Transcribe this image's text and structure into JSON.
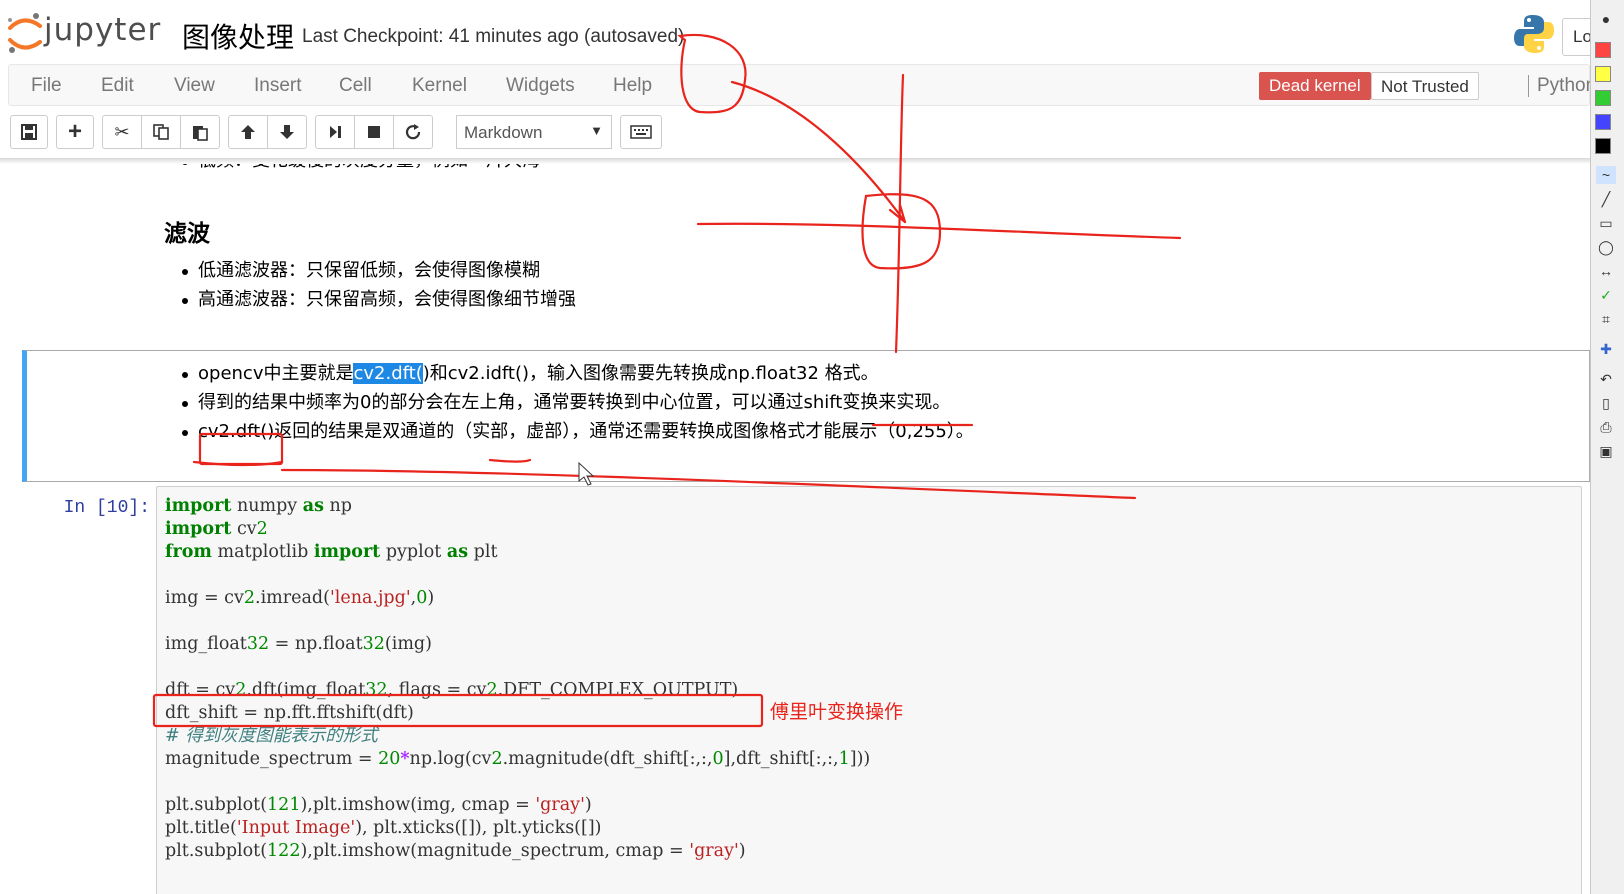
{
  "header": {
    "logo_text": "jupyter",
    "notebook_title": "图像处理",
    "checkpoint": "Last Checkpoint: 41 minutes ago (autosaved)",
    "logout_label": "Lo"
  },
  "menubar": {
    "items": [
      "File",
      "Edit",
      "View",
      "Insert",
      "Cell",
      "Kernel",
      "Widgets",
      "Help"
    ],
    "kernel_status": "Dead kernel",
    "trust_status": "Not Trusted",
    "kernel_name": "Python"
  },
  "toolbar": {
    "cell_type": "Markdown"
  },
  "notebook": {
    "top_bullet": "低频：变化缓慢的灰度分量，例如一片大海",
    "heading": "滤波",
    "filter_bullets": [
      "低通滤波器：只保留低频，会使得图像模糊",
      "高通滤波器：只保留高频，会使得图像细节增强"
    ],
    "selected_cell": {
      "b1_pre": "opencv中主要就是",
      "b1_sel": "cv2.dft(",
      "b1_post": ")和cv2.idft()，输入图像需要先转换成np.float32 格式。",
      "b2": "得到的结果中频率为0的部分会在左上角，通常要转换到中心位置，可以通过shift变换来实现。",
      "b3": "cv2.dft()返回的结果是双通道的（实部，虚部），通常还需要转换成图像格式才能展示（0,255）。"
    },
    "code_cell": {
      "prompt": "In [10]:",
      "lines": [
        "import numpy as np",
        "import cv2",
        "from matplotlib import pyplot as plt",
        "",
        "img = cv2.imread('lena.jpg',0)",
        "",
        "img_float32 = np.float32(img)",
        "",
        "dft = cv2.dft(img_float32, flags = cv2.DFT_COMPLEX_OUTPUT)",
        "dft_shift = np.fft.fftshift(dft)",
        "# 得到灰度图能表示的形式",
        "magnitude_spectrum = 20*np.log(cv2.magnitude(dft_shift[:,:,0],dft_shift[:,:,1]))",
        "",
        "plt.subplot(121),plt.imshow(img, cmap = 'gray')",
        "plt.title('Input Image'), plt.xticks([]), plt.yticks([])",
        "plt.subplot(122),plt.imshow(magnitude_spectrum, cmap = 'gray')"
      ]
    },
    "annotation": "傅里叶变换操作"
  },
  "colors": {
    "dead_kernel": "#d9534f",
    "selected_border": "#42a5f5",
    "annotation": "#e8241d",
    "prompt": "#303f9f"
  }
}
